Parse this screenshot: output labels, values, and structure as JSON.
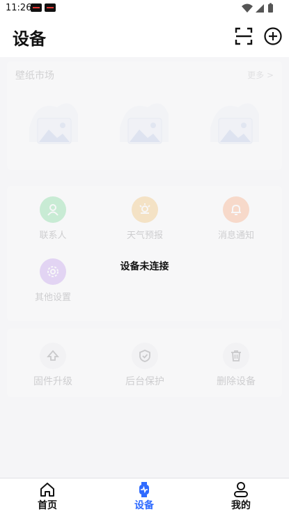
{
  "status_bar": {
    "time": "11:26"
  },
  "header": {
    "title": "设备",
    "scan_icon": "scan-icon",
    "add_icon": "add-circle-icon"
  },
  "wallpaper_market": {
    "title": "壁纸市场",
    "more": "更多 >"
  },
  "features": [
    {
      "label": "联系人",
      "icon": "contact-icon",
      "color": "#2ecc5b"
    },
    {
      "label": "天气预报",
      "icon": "weather-icon",
      "color": "#f4a11a"
    },
    {
      "label": "消息通知",
      "icon": "bell-icon",
      "color": "#ff7a2f"
    },
    {
      "label": "其他设置",
      "icon": "settings-icon",
      "color": "#a065e6"
    }
  ],
  "device_status": "设备未连接",
  "operations": [
    {
      "label": "固件升级",
      "icon": "upgrade-icon"
    },
    {
      "label": "后台保护",
      "icon": "shield-icon"
    },
    {
      "label": "删除设备",
      "icon": "trash-icon"
    }
  ],
  "bottom_nav": [
    {
      "label": "首页",
      "icon": "home-icon",
      "active": false
    },
    {
      "label": "设备",
      "icon": "watch-icon",
      "active": true
    },
    {
      "label": "我的",
      "icon": "profile-icon",
      "active": false
    }
  ],
  "colors": {
    "accent": "#2f6bff"
  }
}
